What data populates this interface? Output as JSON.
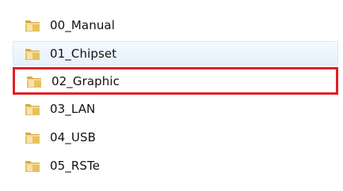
{
  "folders": [
    {
      "name": "00_Manual",
      "state": "normal",
      "icon": "folder-icon"
    },
    {
      "name": "01_Chipset",
      "state": "hover",
      "icon": "folder-icon"
    },
    {
      "name": "02_Graphic",
      "state": "highlighted",
      "icon": "folder-icon"
    },
    {
      "name": "03_LAN",
      "state": "normal",
      "icon": "folder-icon"
    },
    {
      "name": "04_USB",
      "state": "normal",
      "icon": "folder-icon"
    },
    {
      "name": "05_RSTe",
      "state": "normal",
      "icon": "folder-icon"
    }
  ],
  "colors": {
    "highlight_border": "#e01f26",
    "hover_fill": "#e6f1fb",
    "hover_border": "#d6e7f7",
    "folder_body": "#e8c15c",
    "folder_tab": "#d9a93a",
    "text": "#111111"
  }
}
